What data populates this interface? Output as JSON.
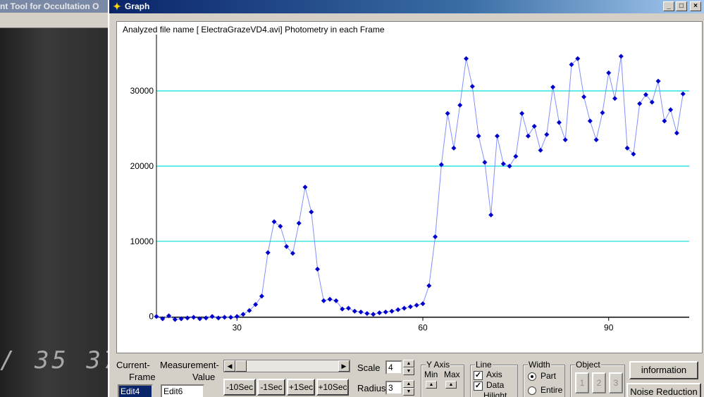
{
  "background_app": {
    "title": "nt Tool for Occultation O",
    "timestamp": "/ 35 37"
  },
  "window": {
    "title": "Graph",
    "minimize": "_",
    "maximize": "□",
    "close": "×"
  },
  "plot": {
    "caption": "Analyzed file name [ ElectraGrazeVD4.avi]    Photometry in each Frame"
  },
  "chart_data": {
    "type": "line",
    "xlim": [
      17,
      103
    ],
    "ylim": [
      -500,
      37500
    ],
    "x_ticks": [
      30,
      60,
      90
    ],
    "y_ticks": [
      0,
      10000,
      20000,
      30000
    ],
    "grid": "horizontal",
    "series": [
      {
        "x": [
          17,
          18,
          19,
          20,
          21,
          22,
          23,
          24,
          25,
          26,
          27,
          28,
          29,
          30,
          31,
          32,
          33,
          34,
          35,
          36,
          37,
          38,
          39,
          40,
          41,
          42,
          43,
          44,
          45,
          46,
          47,
          48,
          49,
          50,
          51,
          52,
          53,
          54,
          55,
          56,
          57,
          58,
          59,
          60,
          61,
          62,
          63,
          64,
          65,
          66,
          67,
          68,
          69,
          70,
          71,
          72,
          73,
          74,
          75,
          76,
          77,
          78,
          79,
          80,
          81,
          82,
          83,
          84,
          85,
          86,
          87,
          88,
          89,
          90,
          91,
          92,
          93,
          94,
          95,
          96,
          97,
          98,
          99,
          100,
          101,
          102
        ],
        "y": [
          0,
          -300,
          100,
          -400,
          -300,
          -200,
          -100,
          -300,
          -200,
          0,
          -200,
          -100,
          -100,
          0,
          300,
          800,
          1600,
          2700,
          8500,
          12600,
          12000,
          9300,
          8400,
          12400,
          17200,
          13900,
          6300,
          2100,
          2300,
          2100,
          1000,
          1100,
          700,
          600,
          400,
          300,
          500,
          600,
          700,
          900,
          1100,
          1300,
          1500,
          1700,
          4100,
          10600,
          20200,
          27000,
          22400,
          28100,
          34300,
          30600,
          24000,
          20500,
          13500,
          24000,
          20300,
          20000,
          21300,
          27000,
          24000,
          25300,
          22100,
          24200,
          30500,
          25800,
          23500,
          33500,
          34300,
          29200,
          26000,
          23500,
          27100,
          32400,
          29000,
          34600,
          22400,
          21600,
          28300,
          29500,
          28500,
          31300,
          26000,
          27500,
          24400,
          29600
        ]
      }
    ]
  },
  "controls": {
    "current_frame_label_1": "Current-",
    "current_frame_label_2": "Frame",
    "current_frame_value": "Edit4",
    "measurement_label_1": "Measurement-",
    "measurement_label_2": "Value",
    "measurement_value": "Edit6",
    "buttons": [
      "-10Sec",
      "-1Sec",
      "+1Sec",
      "+10Sec"
    ],
    "scale_label": "Scale",
    "scale_value": "4",
    "radius_label": "Radius",
    "radius_value": "3",
    "yaxis_title": "Y Axis",
    "yaxis_min": "Min",
    "yaxis_max": "Max",
    "line_title": "Line",
    "line_axis": "Axis",
    "line_data": "Data",
    "line_hilight": "Hilight",
    "width_title": "Width",
    "width_part": "Part",
    "width_entire": "Entire",
    "object_title": "Object",
    "objects": [
      "1",
      "2",
      "3"
    ],
    "information_button": "information",
    "noise_button": "Noise Reduction"
  },
  "colors": {
    "grid": "#00e0e0",
    "line": "#8090ff",
    "marker": "#0000cc"
  }
}
